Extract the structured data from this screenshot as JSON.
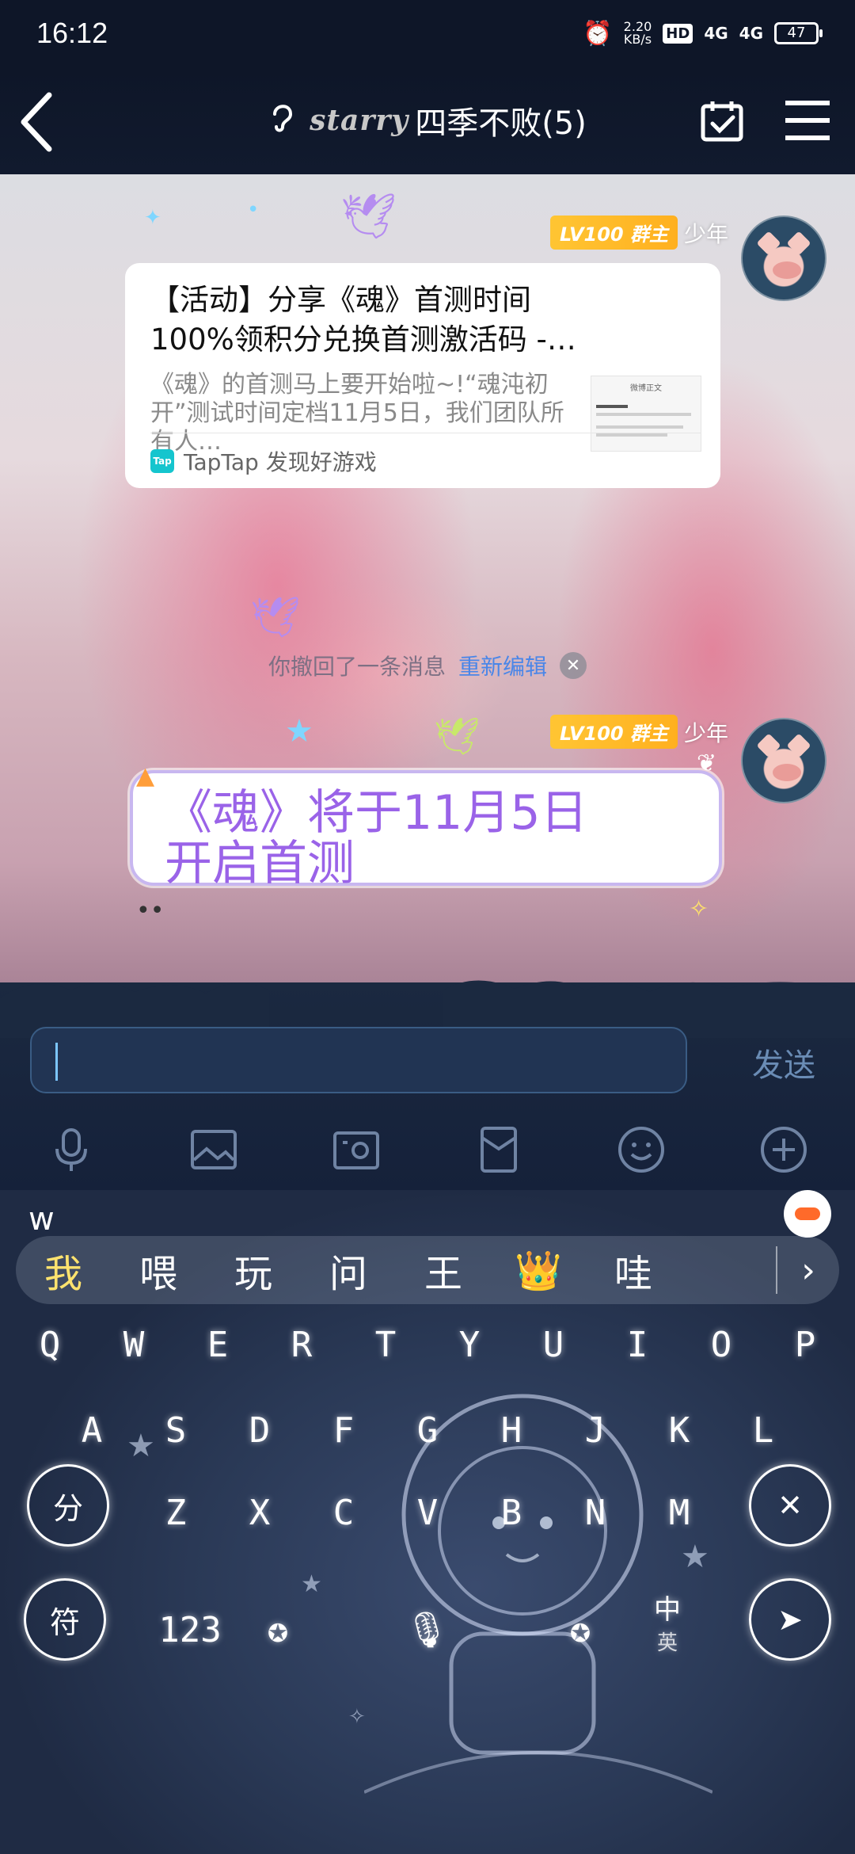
{
  "status": {
    "time": "16:12",
    "net_speed_value": "2.20",
    "net_speed_unit": "KB/s",
    "hd": "HD",
    "signal1": "4G",
    "signal2": "4G",
    "battery": "47"
  },
  "header": {
    "brand": "starry",
    "title": "四季不败(5)",
    "back_icon": "chevron-left-icon",
    "calendar_icon": "calendar-check-icon",
    "menu_icon": "hamburger-icon"
  },
  "messages": [
    {
      "level": "LV100 群主",
      "sender": "少年",
      "card": {
        "title_line1": "【活动】分享《魂》首测时间",
        "title_line2": "100%领积分兑换首测激活码 -…",
        "desc": "《魂》的首测马上要开始啦~!“魂沌初开”测试时间定档11月5日，我们团队所有人…",
        "thumb_head": "微博正文",
        "source": "TapTap 发现好游戏"
      }
    },
    {
      "level": "LV100 群主",
      "sender": "少年",
      "text_line1": "《魂》将于11月5日",
      "text_line2": "开启首测"
    }
  ],
  "recall": {
    "text": "你撤回了一条消息",
    "edit": "重新编辑"
  },
  "input": {
    "value": "",
    "send": "发送"
  },
  "keyboard": {
    "composing": "w",
    "candidates": [
      "我",
      "喂",
      "玩",
      "问",
      "王",
      "👑",
      "哇"
    ],
    "row1": [
      "Q",
      "W",
      "E",
      "R",
      "T",
      "Y",
      "U",
      "I",
      "O",
      "P"
    ],
    "row2": [
      "A",
      "S",
      "D",
      "F",
      "G",
      "H",
      "J",
      "K",
      "L"
    ],
    "row3": [
      "Z",
      "X",
      "C",
      "V",
      "B",
      "N",
      "M"
    ],
    "fen": "分",
    "fu": "符",
    "num": "123",
    "zh": "中",
    "en": "英"
  }
}
